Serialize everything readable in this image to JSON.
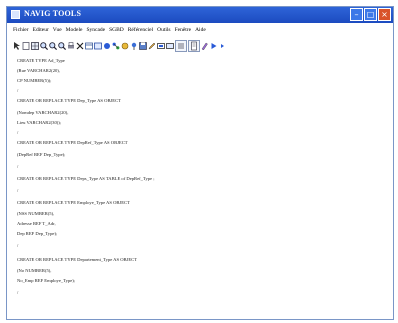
{
  "window": {
    "title": "NAVIG TOOLS"
  },
  "menu": [
    "Fichier",
    "Editeur",
    "Vue",
    "Modele",
    "Syncade",
    "SGBD",
    "Référenciel",
    "Outils",
    "Fenêtre",
    "Aide"
  ],
  "toolbar": {
    "icons": [
      "cursor-icon",
      "new-icon",
      "grid-icon",
      "zoom-in-icon",
      "zoom-out-icon",
      "zoom-fit-icon",
      "print-icon",
      "delete-icon",
      "table-icon",
      "entity-icon",
      "circle-icon",
      "link-icon",
      "color-icon",
      "pin-icon",
      "save-icon",
      "pencil-icon",
      "frame-icon",
      "rect-icon",
      "form-icon",
      "document-icon",
      "pen-icon",
      "play-icon",
      "next-icon"
    ]
  },
  "code": [
    "CREATE TYPE Ad_Type",
    "(Rue VARCHAR2(20),",
    "CP NUMBER(5));",
    "/",
    "CREATE OR REPLACE TYPE Dep_Type AS OBJECT",
    "(Nomdep VARCHAR2(20),",
    "Lieu VARCHAR2(30));",
    "/",
    "CREATE OR REPLACE TYPE DepRef_Type AS OBJECT",
    "(DepRef REF Dep_Type);",
    "/",
    "CREATE OR REPLACE TYPE Deps_Type AS TABLE of DepRef_Type ;",
    "/",
    "CREATE OR REPLACE TYPE Employe_Type AS OBJECT",
    "(NSS NUMBER(5),",
    " Adresse REF T_Adr,",
    " Dep REF Dep_Type);",
    "/",
    "CREATE OR REPLACE TYPE Departement_Type AS OBJECT",
    "(No NUMBER(5),",
    "No_Emp REF Employe_Type);",
    "/"
  ]
}
